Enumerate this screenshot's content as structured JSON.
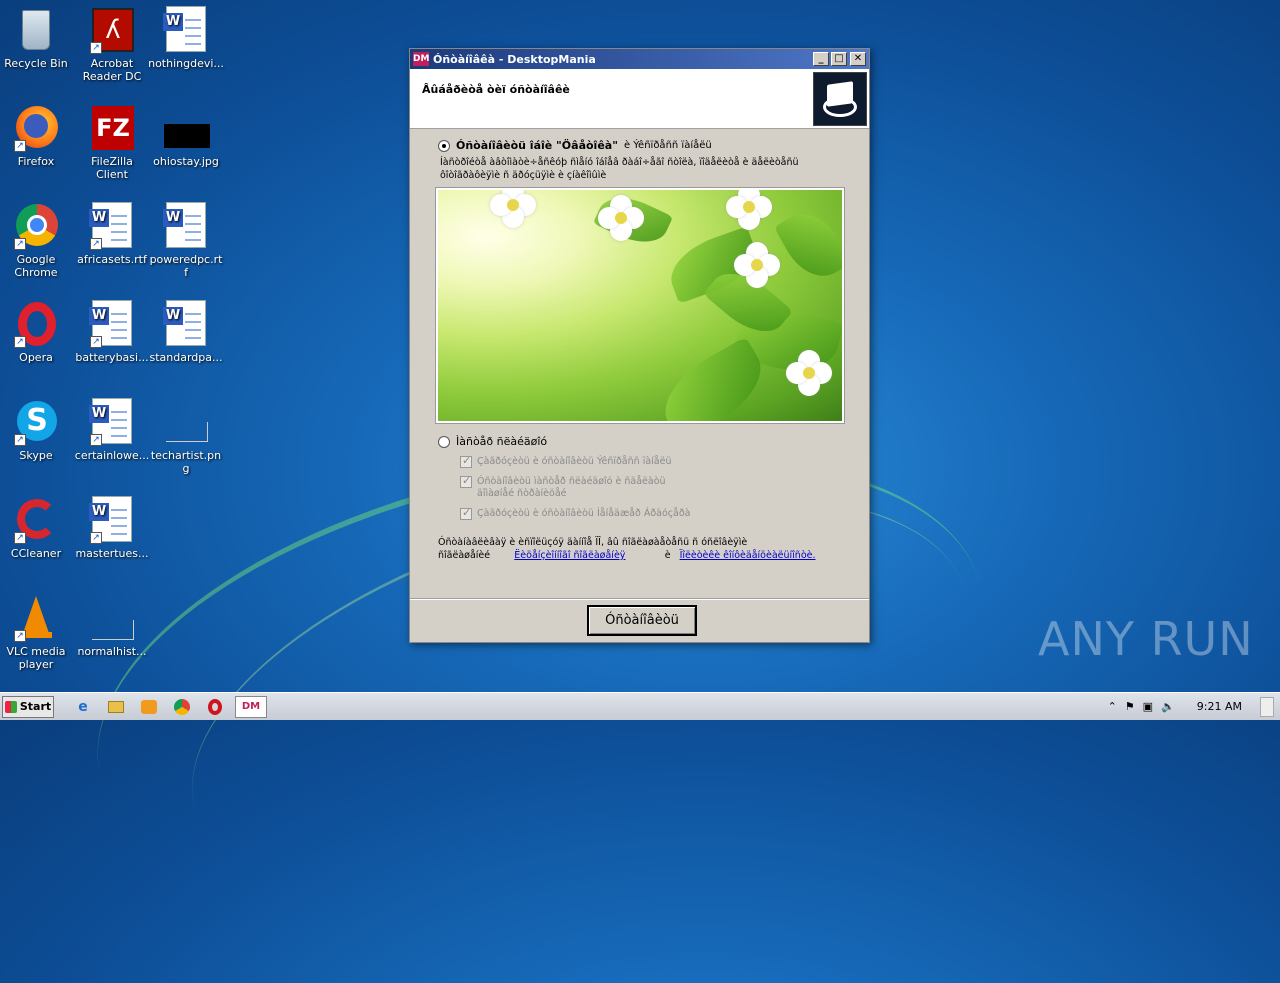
{
  "desktop": {
    "icons": [
      {
        "label": "Recycle Bin",
        "kind": "recycle-bin-icon"
      },
      {
        "label": "Acrobat Reader DC",
        "kind": "acrobat-icon"
      },
      {
        "label": "nothingdevi...",
        "kind": "word-doc-icon"
      },
      {
        "label": "Firefox",
        "kind": "firefox-icon"
      },
      {
        "label": "FileZilla Client",
        "kind": "filezilla-icon"
      },
      {
        "label": "ohiostay.jpg",
        "kind": "image-file-icon"
      },
      {
        "label": "Google Chrome",
        "kind": "chrome-icon"
      },
      {
        "label": "africasets.rtf",
        "kind": "word-doc-icon"
      },
      {
        "label": "poweredpc.rtf",
        "kind": "word-doc-icon"
      },
      {
        "label": "Opera",
        "kind": "opera-icon"
      },
      {
        "label": "batterybasi...",
        "kind": "word-doc-icon"
      },
      {
        "label": "standardpa...",
        "kind": "word-doc-icon"
      },
      {
        "label": "Skype",
        "kind": "skype-icon"
      },
      {
        "label": "certainlowe...",
        "kind": "word-doc-icon"
      },
      {
        "label": "techartist.png",
        "kind": "image-file-icon"
      },
      {
        "label": "CCleaner",
        "kind": "ccleaner-icon"
      },
      {
        "label": "mastertues...",
        "kind": "word-doc-icon"
      },
      {
        "label": "VLC media player",
        "kind": "vlc-icon"
      },
      {
        "label": "normalhist...",
        "kind": "image-file-icon"
      }
    ]
  },
  "dialog": {
    "logo": "DM",
    "title": "Óñòàíîâêà - DesktopMania",
    "header_title": "Âûáåðèòå òèï óñòàíîâêè",
    "option1_label": "Óñòàíîâèòü îáîè \"Öâåòîêà\"",
    "option1_suffix": "è Ýêñïðåññ ïàíåëü",
    "option1_desc": "Íàñòðîéòå àâòîìàòè÷åñêóþ ñìåíó îáîåâ ðàáî÷åãî ñòîëà, ïîäåëèòå è äåëèòåñü ôîòîãðàôèÿìè ñ äðóçüÿìè è çíàêîìûìè",
    "option2_label": "Ìàñòåð ñëàéäøîó",
    "checks": [
      "Çàãðóçèòü è óñòàíîâèòü Ýêñïðåññ ïàíåëü",
      "Óñòàíîâèòü ìàñòåð ñëàéäøîó è ñäåëàòü äîìàøíåé ñòðàíèöåé",
      "Çàãðóçèòü è óñòàíîâèòü Ìåíåäæåð Áðàóçåðà"
    ],
    "footer_text_1": "Óñòàíàâëèâàÿ è èñïîëüçóÿ äàííîå ÏÎ, âû ñîãëàøàåòåñü ñ óñëîâèÿìè",
    "footer_text_2": "ñîãëàøåíèé",
    "footer_link_1": "Ëèöåíçèîííîãî ñîãëàøåíèÿ",
    "footer_and": "è",
    "footer_link_2": "Ïîëèòèêè êîíôèäåíöèàëüíîñòè.",
    "install_button": "Óñòàíîâèòü"
  },
  "taskbar": {
    "start_label": "Start",
    "active_app": "DM",
    "clock": "9:21 AM"
  },
  "watermark": "ANY RUN"
}
